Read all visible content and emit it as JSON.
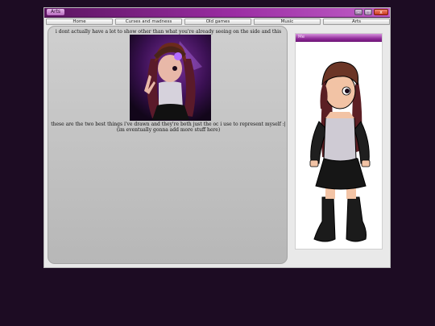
{
  "window": {
    "title": "Arts",
    "controls": {
      "minimize": "–",
      "maximize": "□",
      "close": "x"
    }
  },
  "tabs": [
    {
      "label": "Home"
    },
    {
      "label": "Curses and madness"
    },
    {
      "label": "Old games"
    },
    {
      "label": "Music"
    },
    {
      "label": "Arts"
    }
  ],
  "main": {
    "intro": "i dont actually have a lot to show other than what you're already seeing on the side and this",
    "caption_line1": "these are the two best things i've drawn and they're both just the oc i use to represent myself :|",
    "caption_line2": "(im eventually gonna add more stuff here)"
  },
  "sidebar": {
    "header_label": "Me"
  },
  "colors": {
    "desktop": "#1d0c23",
    "titlebar": "#9b2da3",
    "accent": "#8f2b98",
    "panel": "#c3c3c3"
  }
}
